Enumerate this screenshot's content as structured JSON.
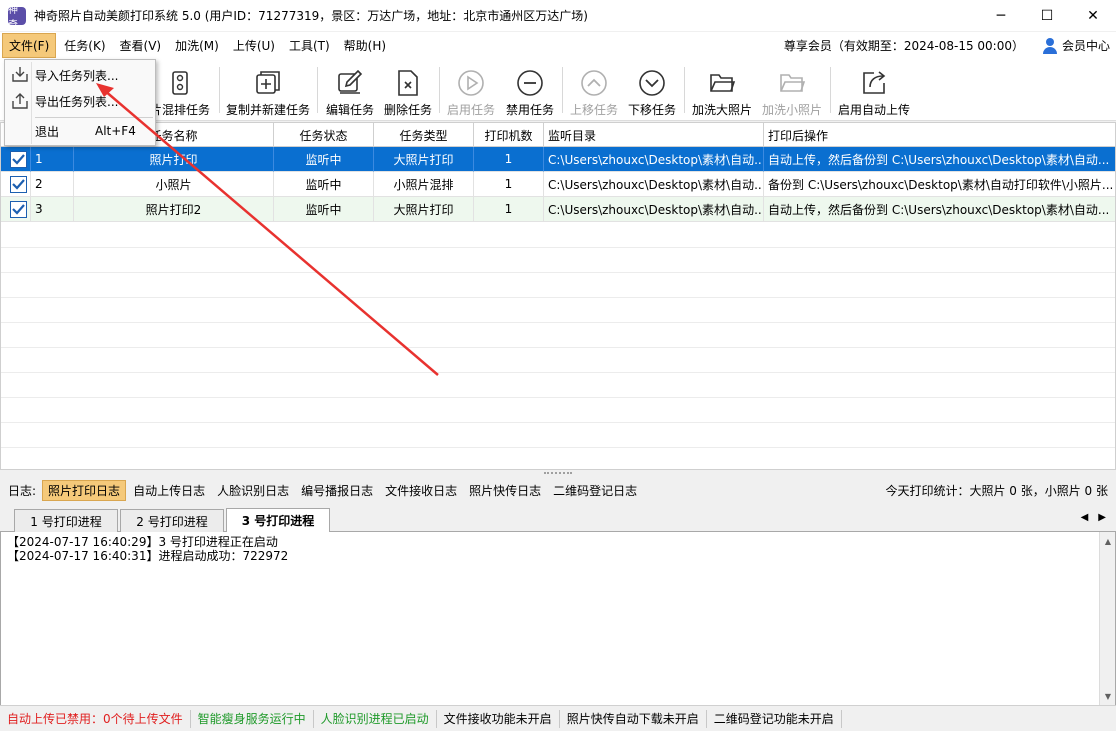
{
  "window": {
    "icon_text": "神奇",
    "title": "神奇照片自动美颜打印系统 5.0 (用户ID：71277319，景区：万达广场，地址：北京市通州区万达广场)",
    "minimize": "─",
    "maximize": "☐",
    "close": "✕"
  },
  "menu": {
    "items": [
      "文件(F)",
      "任务(K)",
      "查看(V)",
      "加洗(M)",
      "上传(U)",
      "工具(T)",
      "帮助(H)"
    ],
    "membership": "尊享会员（有效期至：2024-08-15 00:00）",
    "member_center": "会员中心"
  },
  "file_menu": {
    "import": "导入任务列表...",
    "export": "导出任务列表...",
    "exit": "退出",
    "exit_shortcut": "Alt+F4"
  },
  "toolbar": {
    "buttons": [
      {
        "label": "片混排任务",
        "icon": "grid-photo-icon",
        "enabled": true
      },
      {
        "label": "复制并新建任务",
        "icon": "copy-add-icon",
        "enabled": true
      },
      {
        "label": "编辑任务",
        "icon": "edit-icon",
        "enabled": true
      },
      {
        "label": "删除任务",
        "icon": "delete-file-icon",
        "enabled": true
      },
      {
        "label": "启用任务",
        "icon": "play-circle-icon",
        "enabled": false
      },
      {
        "label": "禁用任务",
        "icon": "minus-circle-icon",
        "enabled": true
      },
      {
        "label": "上移任务",
        "icon": "chevron-up-circle-icon",
        "enabled": false
      },
      {
        "label": "下移任务",
        "icon": "chevron-down-circle-icon",
        "enabled": true
      },
      {
        "label": "加洗大照片",
        "icon": "folder-open-icon",
        "enabled": true
      },
      {
        "label": "加洗小照片",
        "icon": "folder-open-icon",
        "enabled": false
      },
      {
        "label": "启用自动上传",
        "icon": "upload-share-icon",
        "enabled": true
      }
    ]
  },
  "grid": {
    "columns": [
      "",
      "",
      "任务名称",
      "任务状态",
      "任务类型",
      "打印机数",
      "监听目录",
      "打印后操作"
    ],
    "rows": [
      {
        "num": "1",
        "name": "照片打印",
        "status": "监听中",
        "type": "大照片打印",
        "printers": "1",
        "dir": "C:\\Users\\zhouxc\\Desktop\\素材\\自动...",
        "after": "自动上传，然后备份到 C:\\Users\\zhouxc\\Desktop\\素材\\自动..."
      },
      {
        "num": "2",
        "name": "小照片",
        "status": "监听中",
        "type": "小照片混排",
        "printers": "1",
        "dir": "C:\\Users\\zhouxc\\Desktop\\素材\\自动...",
        "after": "备份到 C:\\Users\\zhouxc\\Desktop\\素材\\自动打印软件\\小照片..."
      },
      {
        "num": "3",
        "name": "照片打印2",
        "status": "监听中",
        "type": "大照片打印",
        "printers": "1",
        "dir": "C:\\Users\\zhouxc\\Desktop\\素材\\自动...",
        "after": "自动上传，然后备份到 C:\\Users\\zhouxc\\Desktop\\素材\\自动..."
      }
    ]
  },
  "logs": {
    "label": "日志:",
    "tabs": [
      "照片打印日志",
      "自动上传日志",
      "人脸识别日志",
      "编号播报日志",
      "文件接收日志",
      "照片快传日志",
      "二维码登记日志"
    ],
    "stats": "今天打印统计：大照片 0 张，小照片 0 张"
  },
  "process_tabs": [
    "1 号打印进程",
    "2 号打印进程",
    "3 号打印进程"
  ],
  "log_lines": [
    "【2024-07-17 16:40:29】3 号打印进程正在启动",
    "【2024-07-17 16:40:31】进程启动成功：722972"
  ],
  "status": {
    "items": [
      {
        "text": "自动上传已禁用：0个待上传文件",
        "color": "red"
      },
      {
        "text": "智能瘦身服务运行中",
        "color": "green"
      },
      {
        "text": "人脸识别进程已启动",
        "color": "green"
      },
      {
        "text": "文件接收功能未开启",
        "color": "black"
      },
      {
        "text": "照片快传自动下载未开启",
        "color": "black"
      },
      {
        "text": "二维码登记功能未开启",
        "color": "black"
      }
    ]
  },
  "colors": {
    "selection": "#0a6fd0",
    "menu_highlight": "#f5c97a",
    "annotation_arrow": "#e8322f"
  }
}
